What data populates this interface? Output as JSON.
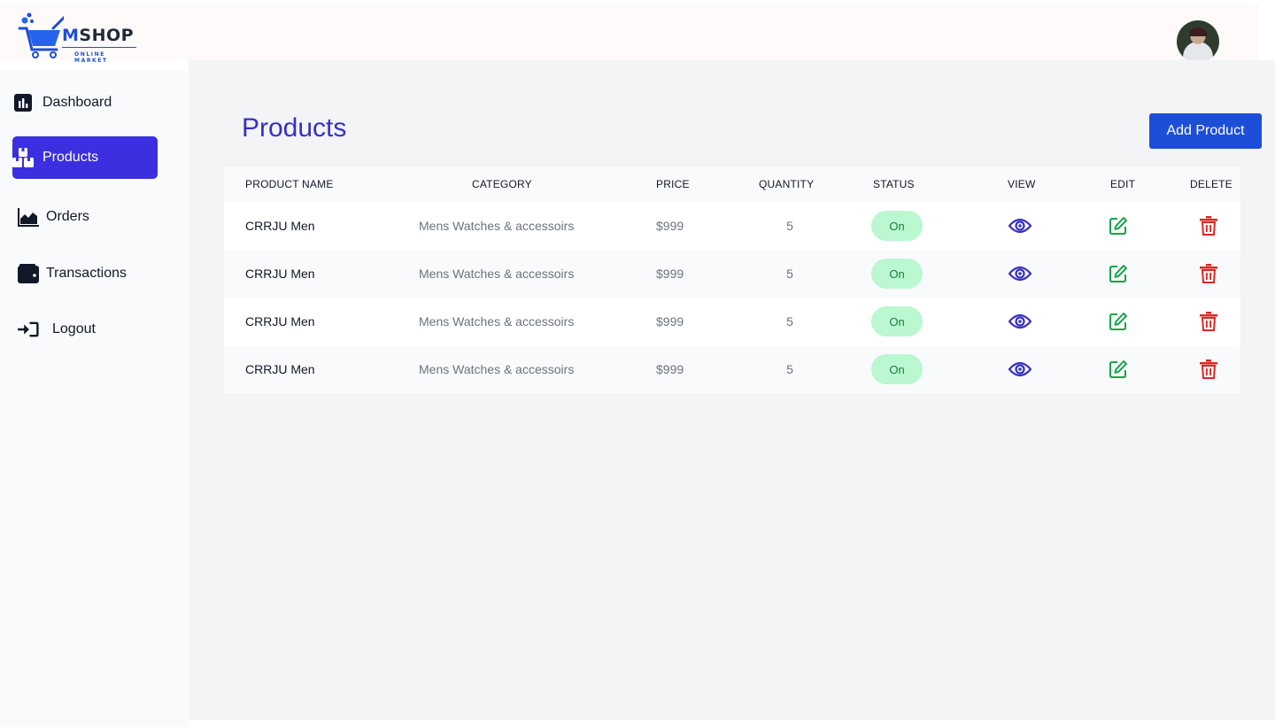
{
  "brand": {
    "name_prefix": "M",
    "name_rest": "SHOP",
    "tagline": "ONLINE MARKET"
  },
  "sidebar": {
    "items": [
      {
        "label": "Dashboard",
        "icon": "chart-bar-icon",
        "active": false
      },
      {
        "label": "Products",
        "icon": "boxes-icon",
        "active": true
      },
      {
        "label": "Orders",
        "icon": "area-chart-icon",
        "active": false
      },
      {
        "label": "Transactions",
        "icon": "wallet-icon",
        "active": false
      },
      {
        "label": "Logout",
        "icon": "sign-in-icon",
        "active": false
      }
    ]
  },
  "main": {
    "title": "Products",
    "add_button": "Add Product"
  },
  "table": {
    "headers": {
      "name": "PRODUCT NAME",
      "category": "CATEGORY",
      "price": "PRICE",
      "quantity": "QUANTITY",
      "status": "STATUS",
      "view": "VIEW",
      "edit": "EDIT",
      "delete": "DELETE"
    },
    "rows": [
      {
        "name": "CRRJU Men",
        "category": "Mens Watches & accessoirs",
        "price": "$999",
        "quantity": "5",
        "status": "On"
      },
      {
        "name": "CRRJU Men",
        "category": "Mens Watches & accessoirs",
        "price": "$999",
        "quantity": "5",
        "status": "On"
      },
      {
        "name": "CRRJU Men",
        "category": "Mens Watches & accessoirs",
        "price": "$999",
        "quantity": "5",
        "status": "On"
      },
      {
        "name": "CRRJU Men",
        "category": "Mens Watches & accessoirs",
        "price": "$999",
        "quantity": "5",
        "status": "On"
      }
    ]
  },
  "colors": {
    "accent": "#3b2fe0",
    "primary_button": "#1d4ed8",
    "view_icon": "#3730c4",
    "edit_icon": "#16a34a",
    "delete_icon": "#dc2626",
    "status_badge_bg": "#bbf7d0"
  }
}
